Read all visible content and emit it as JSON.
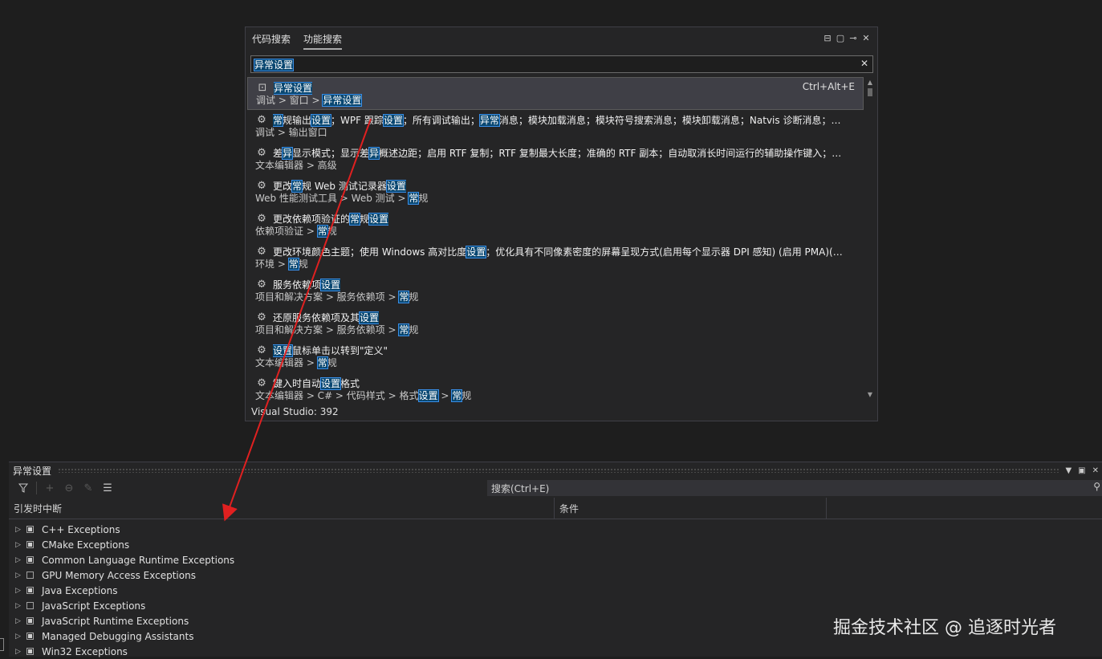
{
  "popup": {
    "tabs": [
      "代码搜索",
      "功能搜索"
    ],
    "active_tab": 1,
    "search_value": "异常设置",
    "results": [
      {
        "title": [
          {
            "t": "异常设置",
            "h": true
          }
        ],
        "path": [
          {
            "t": "调试 > 窗口 > "
          },
          {
            "t": "异常设置",
            "h": true
          }
        ],
        "icon": "settings-window-icon",
        "shortcut": "Ctrl+Alt+E",
        "selected": true
      },
      {
        "title": [
          {
            "t": "常",
            "h": true
          },
          {
            "t": "规输出"
          },
          {
            "t": "设置",
            "h": true
          },
          {
            "t": "；WPF 跟踪"
          },
          {
            "t": "设置",
            "h": true
          },
          {
            "t": "；所有调试输出；"
          },
          {
            "t": "异常",
            "h": true
          },
          {
            "t": "消息；模块加载消息；模块符号搜索消息；模块卸载消息；Natvis 诊断消息；进..."
          }
        ],
        "path": [
          {
            "t": "调试 > 输出窗口"
          }
        ],
        "icon": "gear-icon"
      },
      {
        "title": [
          {
            "t": "差"
          },
          {
            "t": "异",
            "h": true
          },
          {
            "t": "显示模式；显示差"
          },
          {
            "t": "异",
            "h": true
          },
          {
            "t": "概述边距；启用 RTF 复制；RTF 复制最大长度；准确的 RTF 副本；自动取消长时间运行的辅助操作键入；允..."
          }
        ],
        "path": [
          {
            "t": "文本编辑器 > 高级"
          }
        ],
        "icon": "gear-icon"
      },
      {
        "title": [
          {
            "t": "更改"
          },
          {
            "t": "常",
            "h": true
          },
          {
            "t": "规 Web 测试记录器"
          },
          {
            "t": "设置",
            "h": true
          }
        ],
        "path": [
          {
            "t": "Web 性能测试工具 > Web 测试 > "
          },
          {
            "t": "常",
            "h": true
          },
          {
            "t": "规"
          }
        ],
        "icon": "gear-icon"
      },
      {
        "title": [
          {
            "t": "更改依赖项验证的"
          },
          {
            "t": "常",
            "h": true
          },
          {
            "t": "规"
          },
          {
            "t": "设置",
            "h": true
          }
        ],
        "path": [
          {
            "t": "依赖项验证 > "
          },
          {
            "t": "常",
            "h": true
          },
          {
            "t": "规"
          }
        ],
        "icon": "gear-icon"
      },
      {
        "title": [
          {
            "t": "更改环境颜色主题；使用 Windows 高对比度"
          },
          {
            "t": "设置",
            "h": true
          },
          {
            "t": "；优化具有不同像素密度的屏幕呈现方式(启用每个显示器 DPI 感知) (启用 PMA)(多..."
          }
        ],
        "path": [
          {
            "t": "环境 > "
          },
          {
            "t": "常",
            "h": true
          },
          {
            "t": "规"
          }
        ],
        "icon": "gear-icon"
      },
      {
        "title": [
          {
            "t": "服务依赖项"
          },
          {
            "t": "设置",
            "h": true
          }
        ],
        "path": [
          {
            "t": "项目和解决方案 > 服务依赖项 > "
          },
          {
            "t": "常",
            "h": true
          },
          {
            "t": "规"
          }
        ],
        "icon": "gear-icon"
      },
      {
        "title": [
          {
            "t": "还原服务依赖项及其"
          },
          {
            "t": "设置",
            "h": true
          }
        ],
        "path": [
          {
            "t": "项目和解决方案 > 服务依赖项 > "
          },
          {
            "t": "常",
            "h": true
          },
          {
            "t": "规"
          }
        ],
        "icon": "gear-icon"
      },
      {
        "title": [
          {
            "t": "设置",
            "h": true
          },
          {
            "t": "鼠标单击以转到\"定义\""
          }
        ],
        "path": [
          {
            "t": "文本编辑器 > "
          },
          {
            "t": "常",
            "h": true
          },
          {
            "t": "规"
          }
        ],
        "icon": "gear-icon"
      },
      {
        "title": [
          {
            "t": "键入时自动"
          },
          {
            "t": "设置",
            "h": true
          },
          {
            "t": "格式"
          }
        ],
        "path": [
          {
            "t": "文本编辑器 > C# > 代码样式 > 格式"
          },
          {
            "t": "设置",
            "h": true
          },
          {
            "t": " > "
          },
          {
            "t": "常",
            "h": true
          },
          {
            "t": "规"
          }
        ],
        "icon": "gear-icon"
      }
    ],
    "count_label": "Visual Studio: 392"
  },
  "panel": {
    "title": "异常设置",
    "search_placeholder": "搜索(Ctrl+E)",
    "columns": [
      "引发时中断",
      "条件"
    ],
    "rows": [
      {
        "label": "C++ Exceptions",
        "checked": true
      },
      {
        "label": "CMake Exceptions",
        "checked": true
      },
      {
        "label": "Common Language Runtime Exceptions",
        "checked": true
      },
      {
        "label": "GPU Memory Access Exceptions",
        "checked": false
      },
      {
        "label": "Java Exceptions",
        "checked": true
      },
      {
        "label": "JavaScript Exceptions",
        "checked": false
      },
      {
        "label": "JavaScript Runtime Exceptions",
        "checked": true
      },
      {
        "label": "Managed Debugging Assistants",
        "checked": true
      },
      {
        "label": "Win32 Exceptions",
        "checked": true
      }
    ]
  },
  "watermark": "掘金技术社区 @ 追逐时光者",
  "colors": {
    "highlight": "#094771",
    "annotation_arrow": "#e02020"
  }
}
